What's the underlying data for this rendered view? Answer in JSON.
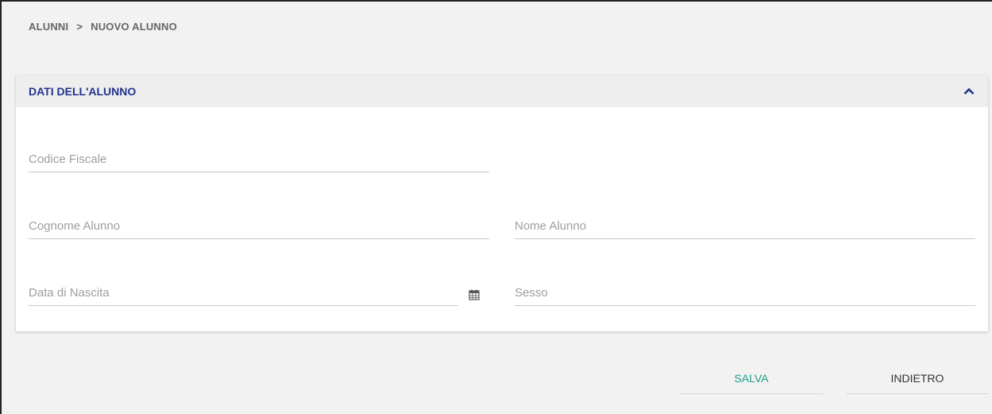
{
  "breadcrumb": {
    "root": "ALUNNI",
    "separator": ">",
    "current": "NUOVO ALUNNO"
  },
  "section": {
    "title": "DATI DELL'ALUNNO",
    "collapse_icon": "chevron-up-icon"
  },
  "fields": {
    "codice_fiscale": {
      "placeholder": "Codice Fiscale",
      "value": ""
    },
    "cognome": {
      "placeholder": "Cognome Alunno",
      "value": ""
    },
    "nome": {
      "placeholder": "Nome Alunno",
      "value": ""
    },
    "data_nascita": {
      "placeholder": "Data di Nascita",
      "value": "",
      "icon": "calendar-icon"
    },
    "sesso": {
      "placeholder": "Sesso",
      "value": ""
    }
  },
  "actions": {
    "save_label": "SALVA",
    "back_label": "INDIETRO"
  },
  "colors": {
    "title": "#22348f",
    "save": "#1e9e8c"
  }
}
